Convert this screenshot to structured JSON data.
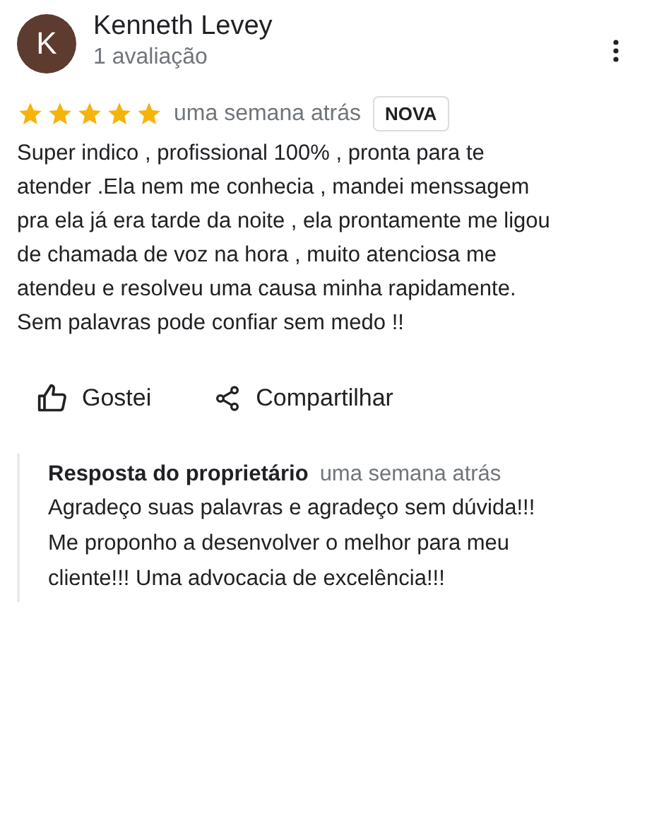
{
  "reviewer": {
    "initial": "K",
    "name": "Kenneth Levey",
    "subtitle": "1 avaliação"
  },
  "rating": {
    "stars": 5,
    "time": "uma semana atrás",
    "badge": "NOVA"
  },
  "review_lines": [
    "Super indico , profissional 100% , pronta para te",
    "atender .Ela nem me conhecia , mandei menssagem",
    "pra ela já era tarde da noite , ela prontamente me ligou",
    "de chamada de voz na hora  , muito atenciosa me",
    "atendeu e resolveu uma causa minha rapidamente.",
    "Sem palavras pode confiar sem medo !!"
  ],
  "actions": [
    {
      "kind": "like",
      "label": "Gostei"
    },
    {
      "kind": "share",
      "label": "Compartilhar"
    }
  ],
  "reply": {
    "title": "Resposta do proprietário",
    "time": "uma semana atrás",
    "lines": [
      "Agradeço suas palavras e agradeço sem dúvida!!!",
      "Me proponho a desenvolver o melhor para meu",
      "cliente!!! Uma advocacia de excelência!!!"
    ]
  }
}
